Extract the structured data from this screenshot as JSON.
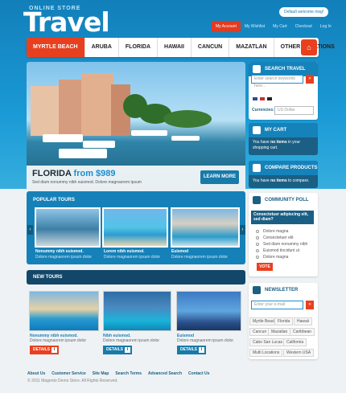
{
  "header": {
    "logo_small": "ONLINE STORE",
    "logo_big": "Travel",
    "welcome": "Default welcome msg!",
    "toplinks": [
      "My Account",
      "My Wishlist",
      "My Cart",
      "Checkout",
      "Log In"
    ]
  },
  "nav": {
    "items": [
      "MYRTLE BEACH",
      "ARUBA",
      "FLORIDA",
      "HAWAII",
      "CANCUN",
      "MAZATLAN",
      "OTHER LOCATIONS"
    ],
    "home_icon": "home-icon"
  },
  "hero": {
    "title": "FLORIDA",
    "price": "from $989",
    "subtitle": "Sed diam nonummy nibh euismod. Dolore magnaorem ipsum",
    "button": "LEARN MORE"
  },
  "search": {
    "title": "SEARCH TRAVEL",
    "placeholder": "Enter search keywords here...",
    "go": "»",
    "currencies_label": "Currencies:",
    "currency_value": "US Dollar"
  },
  "cart": {
    "title": "MY CART",
    "text_pre": "You have ",
    "text_bold": "no items",
    "text_post": " in your shopping cart."
  },
  "compare": {
    "title": "COMPARE PRODUCTS",
    "text_pre": "You have ",
    "text_bold": "no items",
    "text_post": " to compare."
  },
  "poll": {
    "title": "COMMUNITY POLL",
    "question": "Consectetuer adipiscing elit, sed diam?",
    "options": [
      "Dolore magna",
      "Consectetuer elit",
      "Sed diam nonummy nibh",
      "Euismod tincidunt ut",
      "Dolore magna"
    ],
    "vote": "VOTE"
  },
  "newsletter": {
    "title": "NEWSLETTER",
    "placeholder": "Enter your e-mail",
    "go": "»"
  },
  "tags": [
    "Myrtle Beach",
    "Florida",
    "Hawaii",
    "Cancun",
    "Mazatlan",
    "Caribbean",
    "Cabo San Lucas",
    "California",
    "Multi Locations",
    "Western USA"
  ],
  "popular": {
    "title": "POPULAR TOURS",
    "tours": [
      {
        "name": "Nonummy nibh euismod.",
        "desc": "Dolore magnaorem ipsum dolor"
      },
      {
        "name": "Lorem nibh euismod.",
        "desc": "Dolore magnaorem ipsum dolor"
      },
      {
        "name": "Euismod",
        "desc": "Dolore magnaorem ipsum dolor"
      }
    ]
  },
  "new_tours": {
    "title": "NEW TOURS",
    "tours": [
      {
        "name": "Nonummy nibh euismod.",
        "desc": "Dolore magnaorem ipsum dolor",
        "button": "DETAILS",
        "color": "#e8401f"
      },
      {
        "name": "Nibh euismod.",
        "desc": "Dolore magnaorem ipsum dolor",
        "button": "DETAILS",
        "color": "#187aa9"
      },
      {
        "name": "Euismod",
        "desc": "Dolore magnaorem ipsum dolor",
        "button": "DETAILS",
        "color": "#187aa9"
      }
    ]
  },
  "footer": {
    "links": [
      "About Us",
      "Customer Service",
      "Site Map",
      "Search Terms",
      "Advanced Search",
      "Contact Us"
    ],
    "copyright": "© 2011 Magento Demo Store. All Rights Reserved."
  },
  "colors": {
    "accent": "#e8401f",
    "brand_blue": "#1682ba",
    "dark_blue": "#1b5f84"
  }
}
